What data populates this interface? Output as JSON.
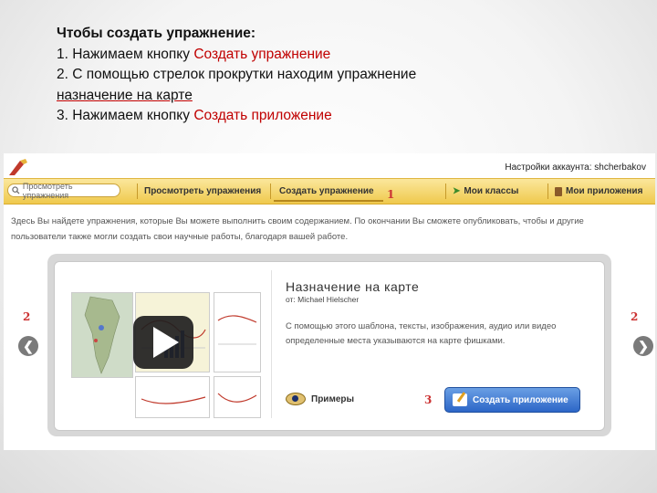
{
  "instructions": {
    "title": "Чтобы создать упражнение:",
    "step1_prefix": "1. Нажимаем кнопку ",
    "step1_action": "Создать упражнение",
    "step2_line1": "2. С помощью стрелок прокрутки находим упражнение",
    "step2_line2": "назначение на карте",
    "step3_prefix": "3. Нажимаем кнопку ",
    "step3_action": "Создать приложение"
  },
  "app": {
    "account_text": "Настройки аккаунта: shcherbakov",
    "search_placeholder": "Просмотреть упражнения",
    "nav": {
      "browse": "Просмотреть упражнения",
      "create": "Создать упражнение",
      "my_classes": "Мои классы",
      "my_apps": "Мои приложения"
    },
    "description": "Здесь Вы найдете упражнения, которые Вы можете выполнить своим содержанием. По окончании Вы сможете опубликовать, чтобы и другие пользователи также могли создать свои научные работы, благодаря вашей работе.",
    "exercise": {
      "title": "Назначение на карте",
      "author": "от: Michael Hielscher",
      "description": "С помощью этого шаблона, тексты, изображения, аудио или видео определенные места указываются на карте фишками.",
      "examples_label": "Примеры",
      "create_app_label": "Создать приложение"
    }
  },
  "markers": {
    "m1": "1",
    "m2_left": "2",
    "m2_right": "2",
    "m3": "3"
  },
  "icons": {
    "prev": "arrow-left-icon",
    "next": "arrow-right-icon",
    "play": "play-icon",
    "eye": "eye-icon"
  },
  "colors": {
    "highlight": "#c00000",
    "nav_bar": "#efc94d",
    "button": "#2c66c7"
  }
}
